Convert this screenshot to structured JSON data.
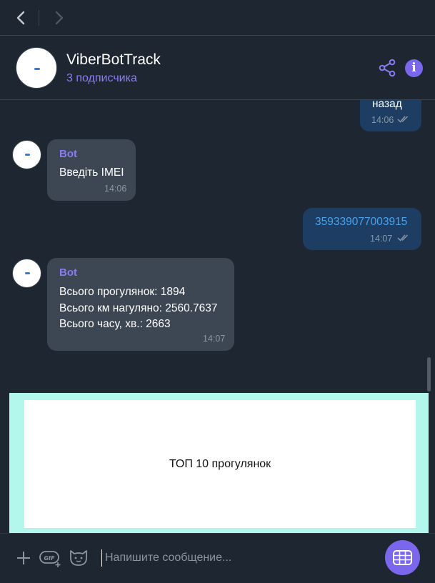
{
  "nav": {
    "back_icon": "chevron-left-icon",
    "forward_icon": "chevron-right-icon"
  },
  "header": {
    "title": "ViberBotTrack",
    "subtitle": "3 подписчика",
    "info_glyph": "i"
  },
  "messages": [
    {
      "direction": "out",
      "text": "назад",
      "time": "14:06"
    },
    {
      "direction": "in",
      "sender": "Bot",
      "text": "Введіть IMEI",
      "time": "14:06"
    },
    {
      "direction": "out",
      "text": "359339077003915",
      "time": "14:07"
    },
    {
      "direction": "in",
      "sender": "Bot",
      "lines": [
        "Всього прогулянок: 1894",
        "Всього км нагуляно: 2560.7637",
        "Всього часу, хв.: 2663"
      ],
      "time": "14:07"
    }
  ],
  "keyboard": {
    "button_label": "ТОП 10 прогулянок"
  },
  "composer": {
    "placeholder": "Напишите сообщение...",
    "icons": [
      "plus-icon",
      "gif-icon",
      "sticker-icon",
      "keyboard-icon"
    ]
  },
  "colors": {
    "background": "#1e2632",
    "accent": "#7b67ee",
    "outgoing_bubble": "#1d3d63",
    "incoming_bubble": "#3d4653",
    "keyboard_frame": "#b2f6ec"
  }
}
